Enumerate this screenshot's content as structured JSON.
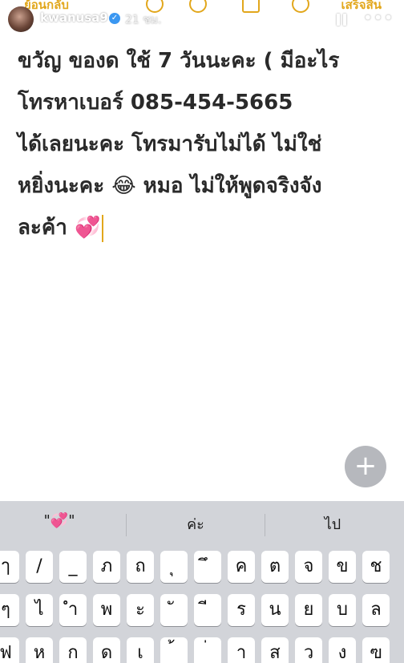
{
  "notes_toolbar": {
    "back_label": "ย้อนกลับ",
    "done_label": "เสร็จสิ้น",
    "accent": "#e2a71c"
  },
  "story": {
    "username": "kwanusa9",
    "timestamp": "21 ชม.",
    "verified_icon": "verified-check-icon",
    "pause_icon": "pause-icon",
    "more_icon": "more-icon"
  },
  "note": {
    "lines": [
      "ขวัญ ของด ใช้ 7 วันนะคะ ( มีอะไร",
      "โทรหาเบอร์ 085-454-5665",
      "ได้เลยนะคะ โทรมารับไม่ได้ ไม่ใช่",
      "หยิ่งนะคะ 😂 หมอ ไม่ให้พูดจริงจัง",
      "ละค้า 💞"
    ]
  },
  "fab": {
    "label": "+"
  },
  "keyboard": {
    "suggestions": [
      "\"💞\"",
      "ค่ะ",
      "ไป"
    ],
    "rows": [
      [
        "ๅ",
        "/",
        "_",
        "ภ",
        "ถ",
        "ุ",
        "ึ",
        "ค",
        "ต",
        "จ",
        "ข",
        "ช"
      ],
      [
        "ๆ",
        "ไ",
        "ำ",
        "พ",
        "ะ",
        "ั",
        "ี",
        "ร",
        "น",
        "ย",
        "บ",
        "ล"
      ],
      [
        "ฟ",
        "ห",
        "ก",
        "ด",
        "เ",
        "้",
        "่",
        "า",
        "ส",
        "ว",
        "ง",
        "ฃ"
      ]
    ]
  }
}
